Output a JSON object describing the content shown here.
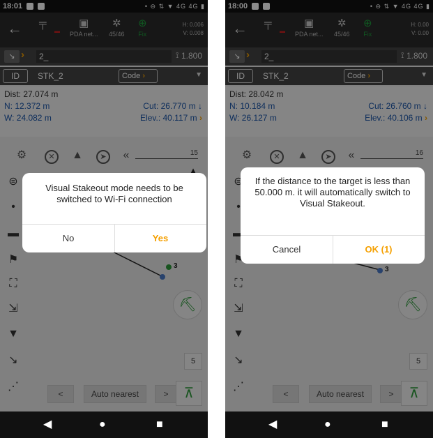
{
  "left": {
    "status": {
      "time": "18:01",
      "icons": "• ⊖ ⇅ ▼ 4G 4G ▮"
    },
    "toolbar": {
      "pda": "PDA net...",
      "sats": "45/46",
      "fix": "Fix",
      "h": "H: 0.006",
      "v": "V: 0.008"
    },
    "point": {
      "name": "2_",
      "height": "1.800"
    },
    "id": {
      "label": "ID",
      "code": "STK_2",
      "code_btn": "Code"
    },
    "info": {
      "dist": "Dist: 27.074 m",
      "n": "N: 12.372 m",
      "w": "W: 24.082 m",
      "cut": "Cut: 26.770 m",
      "elev": "Elev.: 40.117 m"
    },
    "scale": "15",
    "marker": "3",
    "num": "5",
    "bottom": {
      "prev": "<",
      "mode": "Auto nearest",
      "next": ">"
    },
    "dialog": {
      "message": "Visual Stakeout mode needs to be switched to Wi-Fi connection",
      "btn_no": "No",
      "btn_yes": "Yes"
    }
  },
  "right": {
    "status": {
      "time": "18:00",
      "icons": "• ⊖ ⇅ ▼ 4G 4G ▮"
    },
    "toolbar": {
      "pda": "PDA net...",
      "sats": "45/46",
      "fix": "Fix",
      "h": "H: 0.00",
      "v": "V: 0.00"
    },
    "point": {
      "name": "2_",
      "height": "1.800"
    },
    "id": {
      "label": "ID",
      "code": "STK_2",
      "code_btn": "Code"
    },
    "info": {
      "dist": "Dist: 28.042 m",
      "n": "N: 10.184 m",
      "w": "W: 26.127 m",
      "cut": "Cut: 26.760 m",
      "elev": "Elev.: 40.106 m"
    },
    "scale": "16",
    "marker": "3",
    "num": "5",
    "bottom": {
      "prev": "<",
      "mode": "Auto nearest",
      "next": ">"
    },
    "dialog": {
      "message": "If the distance to the target is less than 50.000 m. it will automatically switch to Visual Stakeout.",
      "btn_cancel": "Cancel",
      "btn_ok": "OK (1)"
    }
  },
  "colors": {
    "accent": "#f5a000",
    "blue": "#1a55a8",
    "green": "#2d9a3a"
  }
}
